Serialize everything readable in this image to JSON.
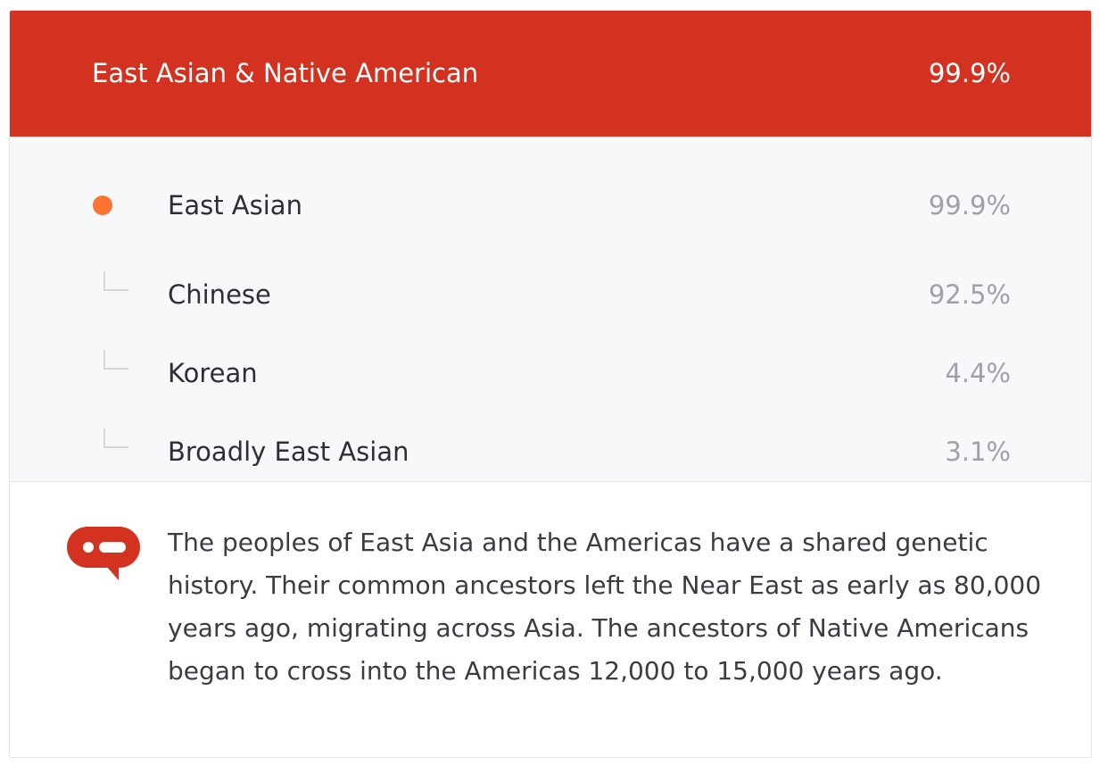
{
  "header": {
    "title": "East Asian & Native American",
    "percent": "99.9%"
  },
  "breakdown": {
    "main": {
      "label": "East Asian",
      "percent": "99.9%",
      "dot_color": "#fd7331"
    },
    "subs": [
      {
        "label": "Chinese",
        "percent": "92.5%"
      },
      {
        "label": "Korean",
        "percent": "4.4%"
      },
      {
        "label": "Broadly East Asian",
        "percent": "3.1%"
      }
    ]
  },
  "info": {
    "icon": "speech-bubble-icon",
    "text": "The peoples of East Asia and the Americas have a shared genetic history. Their common ancestors left the Near East as early as 80,000 years ago, migrating across Asia. The ancestors of Native Americans began to cross into the Americas 12,000 to 15,000 years ago."
  },
  "colors": {
    "accent": "#d2321f",
    "dot": "#fd7331",
    "panel": "#f7f8fa"
  }
}
